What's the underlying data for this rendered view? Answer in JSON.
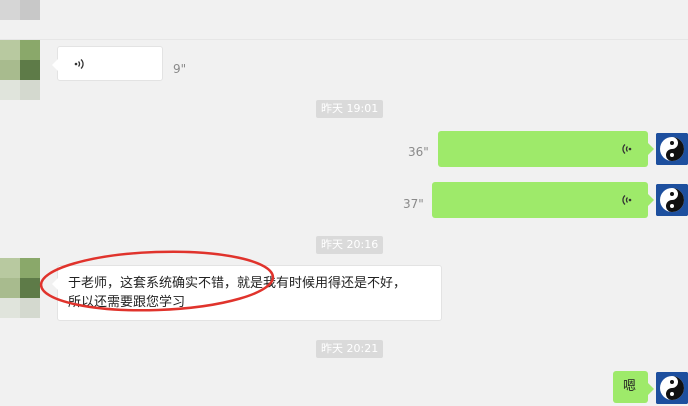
{
  "messages": {
    "m1": {
      "duration": "9\""
    },
    "ts1": "昨天 19:01",
    "m2": {
      "duration": "36\""
    },
    "m3": {
      "duration": "37\""
    },
    "ts2": "昨天 20:16",
    "m4": {
      "line1": "于老师，这套系统确实不错，就是我有时候用得还是不好，",
      "line2": "所以还需要跟您学习"
    },
    "ts3": "昨天 20:21",
    "m5": {
      "text": "嗯"
    }
  },
  "colors": {
    "background": "#f1f1f1",
    "outgoing_bubble": "#9eea6a",
    "incoming_bubble": "#ffffff",
    "annotation": "#e0332c"
  },
  "icons": {
    "voice": "voice-wave-icon",
    "avatar_self": "yin-yang-avatar-icon"
  }
}
